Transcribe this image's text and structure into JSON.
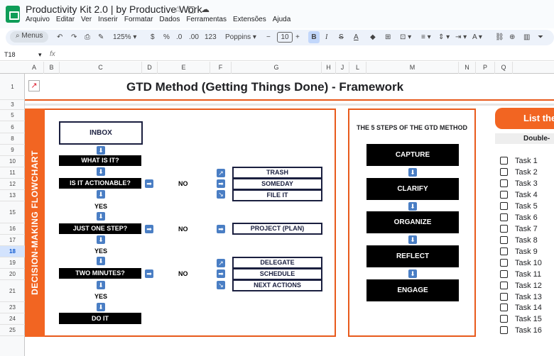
{
  "app": {
    "doc_title": "Productivity Kit 2.0 | by Productive Work",
    "menu": [
      "Arquivo",
      "Editar",
      "Ver",
      "Inserir",
      "Formatar",
      "Dados",
      "Ferramentas",
      "Extensões",
      "Ajuda"
    ]
  },
  "toolbar": {
    "search_label": "Menus",
    "zoom": "125%",
    "currency": "$",
    "percent": "%",
    "dec_less": ".0",
    "dec_more": ".00",
    "number_format": "123",
    "font": "Poppins",
    "font_size": "10",
    "bold": "B",
    "italic": "I"
  },
  "formula_bar": {
    "cell_ref": "T18",
    "fx": "fx"
  },
  "columns": [
    "A",
    "B",
    "C",
    "D",
    "E",
    "F",
    "G",
    "H",
    "J",
    "L",
    "M",
    "N",
    "P",
    "Q"
  ],
  "rows": [
    "1",
    "3",
    "5",
    "6",
    "8",
    "9",
    "10",
    "11",
    "12",
    "13",
    "15",
    "16",
    "17",
    "18",
    "19",
    "20",
    "21",
    "23",
    "24",
    "25"
  ],
  "selected_row": "18",
  "sheet": {
    "title": "GTD Method (Getting Things Done)  - Framework",
    "flow_vertical_label": "DECISION-MAKING FLOWCHART",
    "flow": {
      "inbox": "INBOX",
      "what": "WHAT IS IT?",
      "actionable": "IS IT ACTIONABLE?",
      "no1": "NO",
      "yes1": "YES",
      "one_step": "JUST ONE STEP?",
      "no2": "NO",
      "yes2": "YES",
      "two_minutes": "TWO MINUTES?",
      "no3": "NO",
      "yes3": "YES",
      "do_it": "DO IT",
      "trash": "TRASH",
      "someday": "SOMEDAY",
      "file_it": "FILE IT",
      "project": "PROJECT (PLAN)",
      "delegate": "DELEGATE",
      "schedule": "SCHEDULE",
      "next_actions": "NEXT ACTIONS"
    },
    "steps_title": "THE 5 STEPS OF THE GTD METHOD",
    "steps": [
      "CAPTURE",
      "CLARIFY",
      "ORGANIZE",
      "REFLECT",
      "ENGAGE"
    ],
    "list_banner": "List the",
    "double_banner": "Double-",
    "tasks": [
      "Task 1",
      "Task 2",
      "Task 3",
      "Task 4",
      "Task 5",
      "Task 6",
      "Task 7",
      "Task 8",
      "Task 9",
      "Task 10",
      "Task 11",
      "Task 12",
      "Task 13",
      "Task 14",
      "Task 15",
      "Task 16"
    ]
  }
}
